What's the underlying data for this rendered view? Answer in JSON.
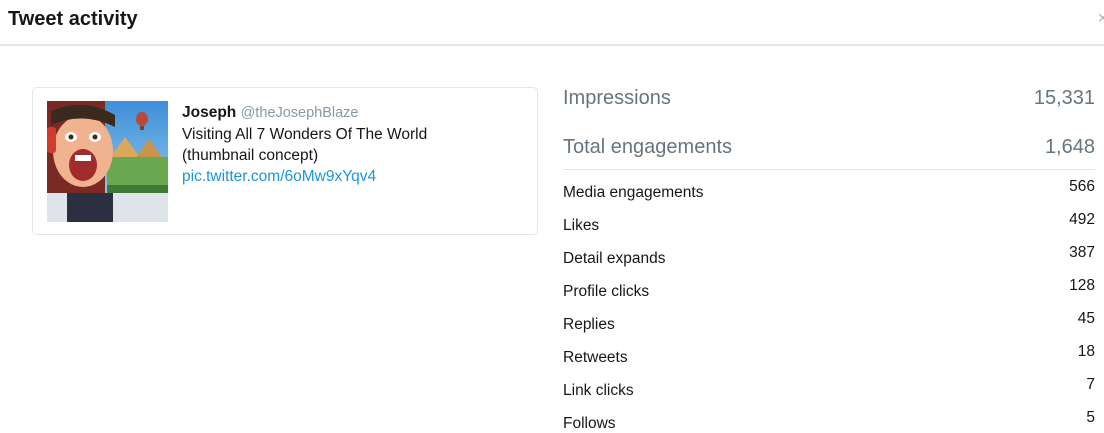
{
  "header": {
    "title": "Tweet activity",
    "close_glyph": "×"
  },
  "tweet": {
    "author_name": "Joseph",
    "author_handle": "@theJosephBlaze",
    "text_line1": "Visiting All 7 Wonders Of The World",
    "text_line2": "(thumbnail concept)",
    "link": "pic.twitter.com/6oMw9xYqv4",
    "thumbnail": "thumbnail-image",
    "link_color": "#1b95e0"
  },
  "stats": {
    "primary": [
      {
        "label": "Impressions",
        "value": "15,331"
      },
      {
        "label": "Total engagements",
        "value": "1,648"
      }
    ],
    "engagements": [
      {
        "label": "Media engagements",
        "value": "566"
      },
      {
        "label": "Likes",
        "value": "492"
      },
      {
        "label": "Detail expands",
        "value": "387"
      },
      {
        "label": "Profile clicks",
        "value": "128"
      },
      {
        "label": "Replies",
        "value": "45"
      },
      {
        "label": "Retweets",
        "value": "18"
      },
      {
        "label": "Link clicks",
        "value": "7"
      },
      {
        "label": "Follows",
        "value": "5"
      }
    ]
  }
}
